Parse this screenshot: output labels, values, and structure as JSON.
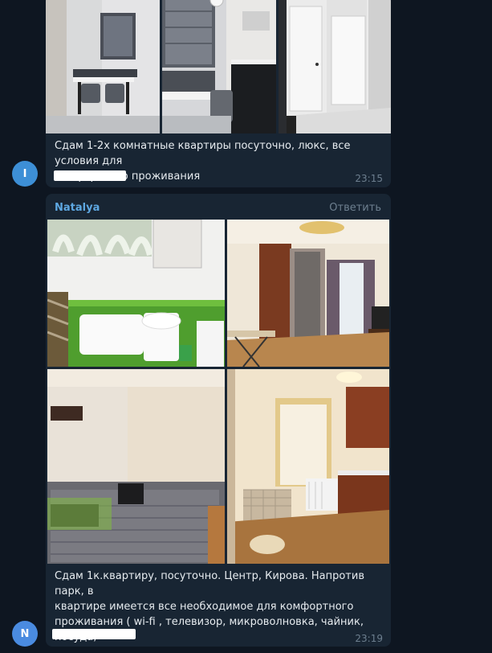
{
  "messages": [
    {
      "avatar_letter": "I",
      "avatar_color": "#3d8fd6",
      "text": "Сдам 1-2х комнатные квартиры посуточно, люкс, все условия для\nкомфортного проживания",
      "time": "23:15",
      "photos": [
        "dining-room-photo",
        "kitchen-photo",
        "hallway-photo"
      ]
    },
    {
      "author": "Natalya",
      "reply_label": "Ответить",
      "avatar_letter": "N",
      "avatar_color": "#4a8be0",
      "text": "Сдам  1к.квартиру, посуточно.   Центр, Кирова. Напротив парк, в\nквартире имеется все необходимое для комфортного\nпроживания ( wi-fi , телевизор, микроволновка, чайник, посуда,\nстиральная машинка, кондиционер, холодильник , бойлер.)",
      "time": "23:19",
      "photos": [
        "bathroom-photo",
        "living-room-photo",
        "bedroom-photo",
        "kitchen-photo"
      ]
    }
  ]
}
